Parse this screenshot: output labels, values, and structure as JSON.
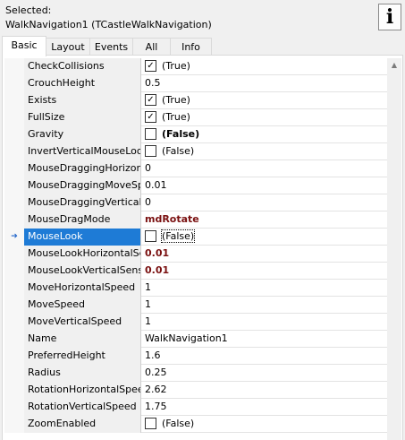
{
  "header": {
    "selected_label": "Selected:",
    "selected_object": "WalkNavigation1 (TCastleWalkNavigation)",
    "info_button_glyph": "i"
  },
  "tabs": [
    {
      "label": "Basic",
      "active": true
    },
    {
      "label": "Layout",
      "active": false
    },
    {
      "label": "Events",
      "active": false
    },
    {
      "label": "All",
      "active": false
    },
    {
      "label": "Info",
      "active": false
    }
  ],
  "scrollbar": {
    "up_glyph": "▲"
  },
  "properties": [
    {
      "name": "CheckCollisions",
      "value": "(True)",
      "checkbox": true,
      "checked": true,
      "style": "normal"
    },
    {
      "name": "CrouchHeight",
      "value": "0.5",
      "checkbox": false,
      "style": "normal"
    },
    {
      "name": "Exists",
      "value": "(True)",
      "checkbox": true,
      "checked": true,
      "style": "normal"
    },
    {
      "name": "FullSize",
      "value": "(True)",
      "checkbox": true,
      "checked": true,
      "style": "normal"
    },
    {
      "name": "Gravity",
      "value": "(False)",
      "checkbox": true,
      "checked": false,
      "style": "boldblack"
    },
    {
      "name": "InvertVerticalMouseLoo",
      "value": "(False)",
      "checkbox": true,
      "checked": false,
      "style": "normal"
    },
    {
      "name": "MouseDraggingHorizor",
      "value": "0",
      "checkbox": false,
      "style": "normal"
    },
    {
      "name": "MouseDraggingMoveSp",
      "value": "0.01",
      "checkbox": false,
      "style": "normal"
    },
    {
      "name": "MouseDraggingVerticall",
      "value": "0",
      "checkbox": false,
      "style": "normal"
    },
    {
      "name": "MouseDragMode",
      "value": "mdRotate",
      "checkbox": false,
      "style": "bold"
    },
    {
      "name": "MouseLook",
      "value": "(False)",
      "checkbox": true,
      "checked": false,
      "style": "normal",
      "selected": true,
      "gutter_glyph": "➔"
    },
    {
      "name": "MouseLookHorizontalSe",
      "value": "0.01",
      "checkbox": false,
      "style": "bold"
    },
    {
      "name": "MouseLookVerticalSens",
      "value": "0.01",
      "checkbox": false,
      "style": "bold"
    },
    {
      "name": "MoveHorizontalSpeed",
      "value": "1",
      "checkbox": false,
      "style": "normal"
    },
    {
      "name": "MoveSpeed",
      "value": "1",
      "checkbox": false,
      "style": "normal"
    },
    {
      "name": "MoveVerticalSpeed",
      "value": "1",
      "checkbox": false,
      "style": "normal"
    },
    {
      "name": "Name",
      "value": "WalkNavigation1",
      "checkbox": false,
      "style": "normal"
    },
    {
      "name": "PreferredHeight",
      "value": "1.6",
      "checkbox": false,
      "style": "normal"
    },
    {
      "name": "Radius",
      "value": "0.25",
      "checkbox": false,
      "style": "normal"
    },
    {
      "name": "RotationHorizontalSpee",
      "value": "2.62",
      "checkbox": false,
      "style": "normal"
    },
    {
      "name": "RotationVerticalSpeed",
      "value": "1.75",
      "checkbox": false,
      "style": "normal"
    },
    {
      "name": "ZoomEnabled",
      "value": "(False)",
      "checkbox": true,
      "checked": false,
      "style": "normal"
    }
  ]
}
